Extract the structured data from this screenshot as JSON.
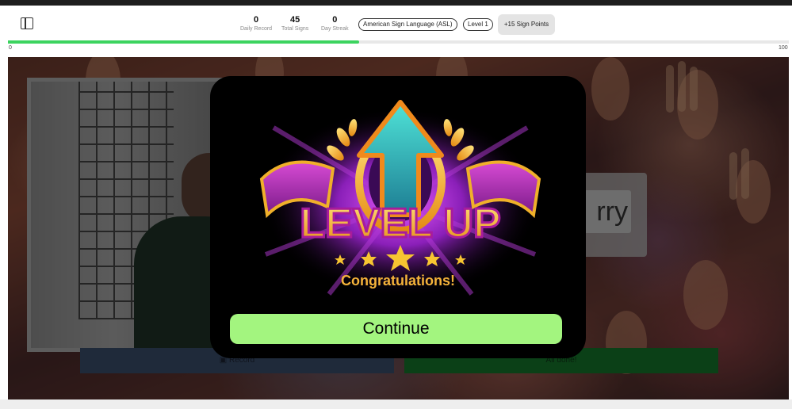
{
  "header": {
    "stats": [
      {
        "value": "0",
        "label": "Daily Record"
      },
      {
        "value": "45",
        "label": "Total Signs"
      },
      {
        "value": "0",
        "label": "Day Streak"
      }
    ],
    "language": "American Sign Language (ASL)",
    "level": "Level 1",
    "points_button": "+15 Sign Points"
  },
  "progress": {
    "min_label": "0",
    "max_label": "100",
    "value": 45
  },
  "practice": {
    "sign_word": "rry",
    "record_label": "Record",
    "done_label": "All done!"
  },
  "modal": {
    "badge_text": "LEVEL UP",
    "congrats": "Congratulations!",
    "continue_label": "Continue"
  },
  "colors": {
    "progress": "#3cd45f",
    "continue": "#a3f57f",
    "done": "#15752a",
    "record": "#3a4d6b"
  },
  "icons": {
    "sidebar": "sidebar-toggle-icon",
    "record": "camera-icon",
    "badge_arrow": "up-arrow-icon",
    "stars": "star-icon"
  }
}
